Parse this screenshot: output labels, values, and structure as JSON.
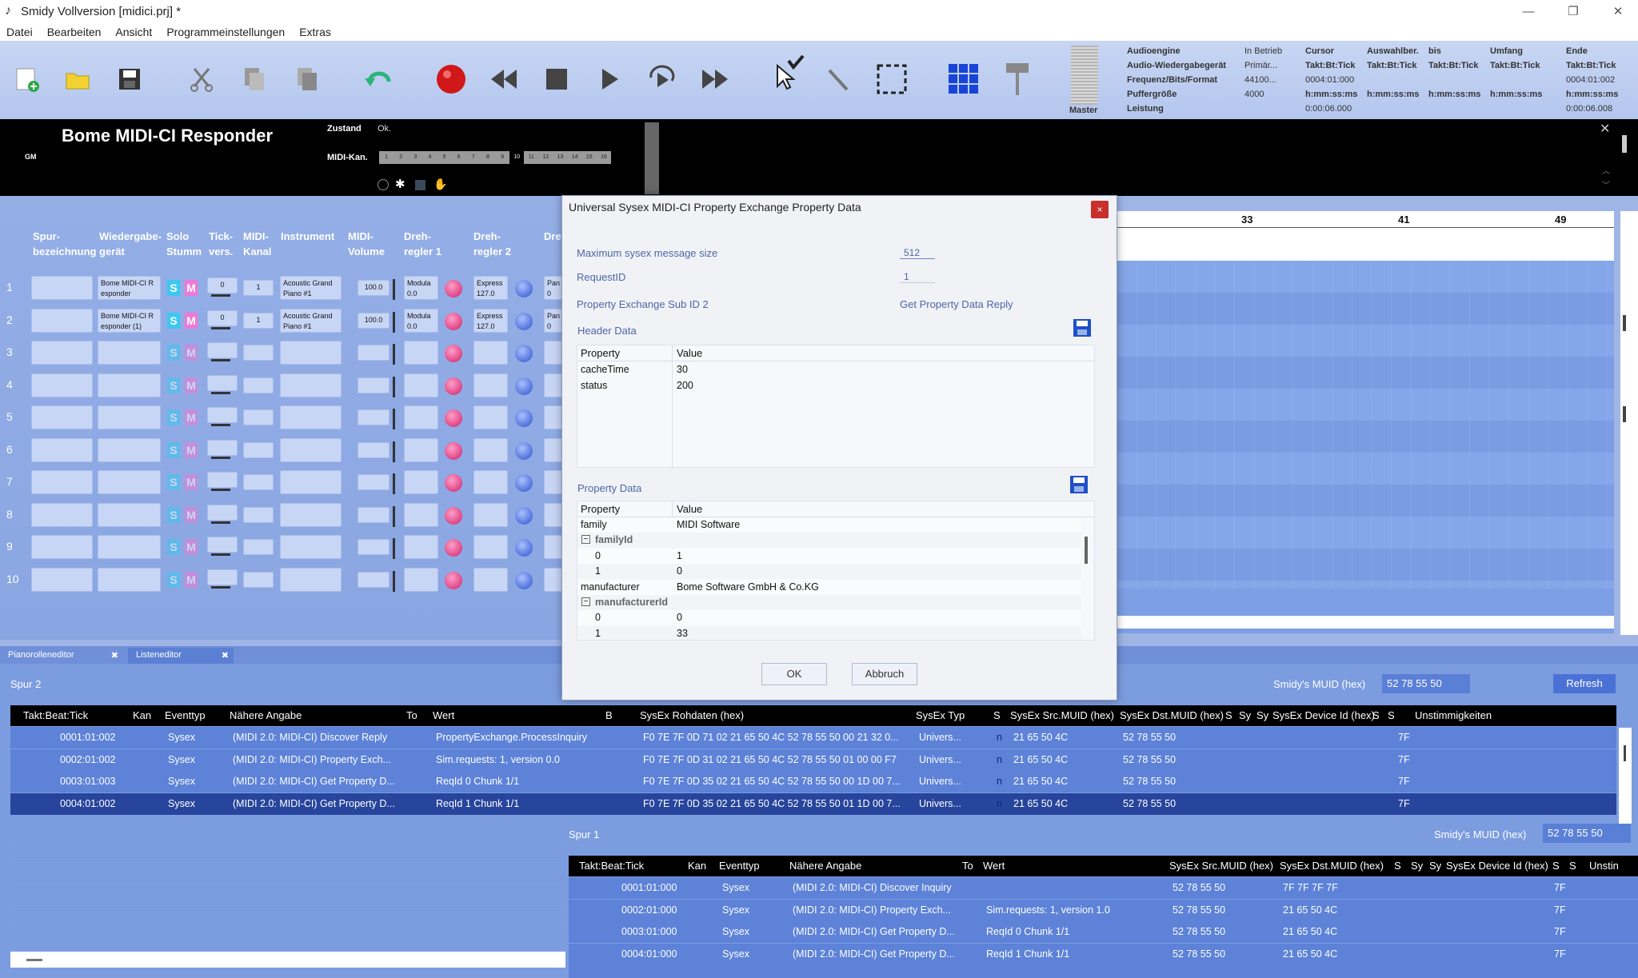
{
  "window": {
    "title": "Smidy Vollversion [midici.prj] *"
  },
  "menu": [
    "Datei",
    "Bearbeiten",
    "Ansicht",
    "Programmeinstellungen",
    "Extras"
  ],
  "toolbar": {
    "master_label": "Master",
    "info_labels": [
      "Audioengine",
      "Audio-Wiedergabegerät",
      "Frequenz/Bits/Format",
      "Puffergröße",
      "Leistung"
    ],
    "info_values": [
      "In Betrieb",
      "Primär...",
      "44100...",
      "4000"
    ],
    "cursor": {
      "header": "Cursor",
      "rows": [
        "Takt:Bt:Tick",
        "0004:01:000",
        "h:mm:ss:ms",
        "0:00:06.000"
      ]
    },
    "auswahl": {
      "header": "Auswahlber.",
      "rows": [
        "Takt:Bt:Tick",
        "",
        "h:mm:ss:ms"
      ]
    },
    "bis": {
      "header": "bis",
      "rows": [
        "Takt:Bt:Tick",
        "",
        "h:mm:ss:ms"
      ]
    },
    "umfang": {
      "header": "Umfang",
      "rows": [
        "Takt:Bt:Tick",
        "",
        "h:mm:ss:ms"
      ]
    },
    "ende": {
      "header": "Ende",
      "rows": [
        "Takt:Bt:Tick",
        "0004:01:002",
        "h:mm:ss:ms",
        "0:00:06.008"
      ]
    }
  },
  "instrument": {
    "name": "Bome MIDI-CI Responder",
    "gm": "GM",
    "zustand_label": "Zustand",
    "zustand_value": "Ok.",
    "kanal_label": "MIDI-Kan.",
    "kanal_nums": [
      "1",
      "2",
      "3",
      "4",
      "5",
      "6",
      "7",
      "8",
      "9",
      "10",
      "11",
      "12",
      "13",
      "14",
      "15",
      "16"
    ],
    "kanal_selected": "10"
  },
  "track_headers": {
    "spur": "Spur-\nbezeichnung",
    "geraet": "Wiedergabe-\ngerät",
    "solo": "Solo\nStumm",
    "tick": "Tick-\nvers.",
    "kanal": "MIDI-\nKanal",
    "instrument": "Instrument",
    "volume": "MIDI-\nVolume",
    "dreh1": "Dreh-\nregler 1",
    "dreh2": "Dreh-\nregler 2",
    "dreh3": "Dre"
  },
  "tracks": [
    {
      "num": "1",
      "device": "Bome MIDI-CI R\nesponder",
      "tick": "0",
      "kanal": "1",
      "instrument": "Acoustic Grand\nPiano #1",
      "volume": "100.0",
      "dreh1": "Modula\n0.0",
      "dreh2": "Express\n127.0",
      "dreh3": "Pan\n0",
      "s": "S",
      "m": "M"
    },
    {
      "num": "2",
      "device": "Bome MIDI-CI R\nesponder (1)",
      "tick": "0",
      "kanal": "1",
      "instrument": "Acoustic Grand\nPiano #1",
      "volume": "100.0",
      "dreh1": "Modula\n0.0",
      "dreh2": "Express\n127.0",
      "dreh3": "Pan\n0",
      "s": "S",
      "m": "M"
    },
    {
      "num": "3",
      "device": "",
      "tick": "",
      "kanal": "",
      "instrument": "",
      "volume": "",
      "dreh1": "",
      "dreh2": "",
      "dreh3": "",
      "s": "S",
      "m": "M"
    },
    {
      "num": "4",
      "device": "",
      "tick": "",
      "kanal": "",
      "instrument": "",
      "volume": "",
      "dreh1": "",
      "dreh2": "",
      "dreh3": "",
      "s": "S",
      "m": "M"
    },
    {
      "num": "5",
      "device": "",
      "tick": "",
      "kanal": "",
      "instrument": "",
      "volume": "",
      "dreh1": "",
      "dreh2": "",
      "dreh3": "",
      "s": "S",
      "m": "M"
    },
    {
      "num": "6",
      "device": "",
      "tick": "",
      "kanal": "",
      "instrument": "",
      "volume": "",
      "dreh1": "",
      "dreh2": "",
      "dreh3": "",
      "s": "S",
      "m": "M"
    },
    {
      "num": "7",
      "device": "",
      "tick": "",
      "kanal": "",
      "instrument": "",
      "volume": "",
      "dreh1": "",
      "dreh2": "",
      "dreh3": "",
      "s": "S",
      "m": "M"
    },
    {
      "num": "8",
      "device": "",
      "tick": "",
      "kanal": "",
      "instrument": "",
      "volume": "",
      "dreh1": "",
      "dreh2": "",
      "dreh3": "",
      "s": "S",
      "m": "M"
    },
    {
      "num": "9",
      "device": "",
      "tick": "",
      "kanal": "",
      "instrument": "",
      "volume": "",
      "dreh1": "",
      "dreh2": "",
      "dreh3": "",
      "s": "S",
      "m": "M"
    },
    {
      "num": "10",
      "device": "",
      "tick": "",
      "kanal": "",
      "instrument": "",
      "volume": "",
      "dreh1": "",
      "dreh2": "",
      "dreh3": "",
      "s": "S",
      "m": "M"
    }
  ],
  "ruler": [
    "33",
    "41",
    "49"
  ],
  "tabs": [
    "Pianorolleneditor",
    "Listeneditor"
  ],
  "list1": {
    "title": "Spur 2",
    "muid_label": "Smidy's MUID (hex)",
    "muid_value": "52 78 55 50",
    "refresh": "Refresh",
    "headers": [
      "Takt:Beat:Tick",
      "Kan",
      "Eventtyp",
      "Nähere Angabe",
      "To",
      "Wert",
      "B",
      "SysEx Rohdaten (hex)",
      "SysEx Typ",
      "S",
      "SysEx Src.MUID (hex)",
      "SysEx Dst.MUID (hex)",
      "S",
      "Sy",
      "Sy",
      "SysEx Device Id (hex)",
      "S",
      "S",
      "Unstimmigkeiten"
    ],
    "rows": [
      [
        "0001:01:002",
        "",
        "Sysex",
        "(MIDI 2.0: MIDI-CI) Discover Reply",
        "",
        "PropertyExchange.ProcessInquiry",
        "",
        "F0 7E 7F 0D 71 02 21 65 50 4C 52 78 55 50 00 21 32 0...",
        "Univers...",
        "n",
        "21 65 50 4C",
        "52 78 55 50",
        "",
        "",
        "",
        "7F",
        "",
        "",
        ""
      ],
      [
        "0002:01:002",
        "",
        "Sysex",
        "(MIDI 2.0: MIDI-CI) Property Exch...",
        "",
        "Sim.requests: 1, version 0.0",
        "",
        "F0 7E 7F 0D 31 02 21 65 50 4C 52 78 55 50 01 00 00 F7",
        "Univers...",
        "n",
        "21 65 50 4C",
        "52 78 55 50",
        "",
        "",
        "",
        "7F",
        "",
        "",
        ""
      ],
      [
        "0003:01:003",
        "",
        "Sysex",
        "(MIDI 2.0: MIDI-CI) Get Property D...",
        "",
        "ReqId 0 Chunk 1/1",
        "",
        "F0 7E 7F 0D 35 02 21 65 50 4C 52 78 55 50 00 1D 00 7...",
        "Univers...",
        "n",
        "21 65 50 4C",
        "52 78 55 50",
        "",
        "",
        "",
        "7F",
        "",
        "",
        ""
      ],
      [
        "0004:01:002",
        "",
        "Sysex",
        "(MIDI 2.0: MIDI-CI) Get Property D...",
        "",
        "ReqId 1 Chunk 1/1",
        "",
        "F0 7E 7F 0D 35 02 21 65 50 4C 52 78 55 50 01 1D 00 7...",
        "Univers...",
        "n",
        "21 65 50 4C",
        "52 78 55 50",
        "",
        "",
        "",
        "7F",
        "",
        "",
        ""
      ]
    ]
  },
  "list2": {
    "title": "Spur 1",
    "muid_label": "Smidy's MUID (hex)",
    "muid_value": "52 78 55 50",
    "headers": [
      "Takt:Beat:Tick",
      "Kan",
      "Eventtyp",
      "Nähere Angabe",
      "To",
      "Wert",
      "SysEx Src.MUID (hex)",
      "SysEx Dst.MUID (hex)",
      "S",
      "Sy",
      "Sy",
      "SysEx Device Id (hex)",
      "S",
      "S",
      "Unstin"
    ],
    "rows": [
      [
        "0001:01:000",
        "",
        "Sysex",
        "(MIDI 2.0: MIDI-CI) Discover Inquiry",
        "",
        "",
        "52 78 55 50",
        "7F 7F 7F 7F",
        "",
        "",
        "",
        "7F",
        "",
        "",
        ""
      ],
      [
        "0002:01:000",
        "",
        "Sysex",
        "(MIDI 2.0: MIDI-CI) Property Exch...",
        "",
        "Sim.requests: 1, version 1.0",
        "52 78 55 50",
        "21 65 50 4C",
        "",
        "",
        "",
        "7F",
        "",
        "",
        ""
      ],
      [
        "0003:01:000",
        "",
        "Sysex",
        "(MIDI 2.0: MIDI-CI) Get Property D...",
        "",
        "ReqId 0 Chunk 1/1",
        "52 78 55 50",
        "21 65 50 4C",
        "",
        "",
        "",
        "7F",
        "",
        "",
        ""
      ],
      [
        "0004:01:000",
        "",
        "Sysex",
        "(MIDI 2.0: MIDI-CI) Get Property D...",
        "",
        "ReqId 1 Chunk 1/1",
        "52 78 55 50",
        "21 65 50 4C",
        "",
        "",
        "",
        "7F",
        "",
        "",
        ""
      ]
    ]
  },
  "dialog": {
    "title": "Universal Sysex MIDI-CI Property Exchange Property Data",
    "close": "×",
    "max_size_label": "Maximum sysex message size",
    "max_size_value": "512",
    "request_label": "RequestID",
    "request_value": "1",
    "subid_label": "Property Exchange Sub ID 2",
    "subid_value": "Get Property Data Reply",
    "header_section": "Header Data",
    "property_section": "Property Data",
    "col_property": "Property",
    "col_value": "Value",
    "header_rows": [
      [
        "cacheTime",
        "30"
      ],
      [
        "status",
        "200"
      ]
    ],
    "property_rows": [
      {
        "k": "family",
        "v": "MIDI Software",
        "level": 0,
        "group": false
      },
      {
        "k": "familyId",
        "v": "",
        "level": 0,
        "group": true
      },
      {
        "k": "0",
        "v": "1",
        "level": 1,
        "group": false
      },
      {
        "k": "1",
        "v": "0",
        "level": 1,
        "group": false
      },
      {
        "k": "manufacturer",
        "v": "Bome Software GmbH & Co.KG",
        "level": 0,
        "group": false
      },
      {
        "k": "manufacturerId",
        "v": "",
        "level": 0,
        "group": true
      },
      {
        "k": "0",
        "v": "0",
        "level": 1,
        "group": false
      },
      {
        "k": "1",
        "v": "33",
        "level": 1,
        "group": false
      }
    ],
    "ok": "OK",
    "cancel": "Abbruch"
  },
  "colors": {
    "accent": "#4a72d6",
    "selected_row": "#27459c",
    "header_black": "#000000",
    "solo": "#3cc8f0",
    "mute": "#f078d8"
  }
}
